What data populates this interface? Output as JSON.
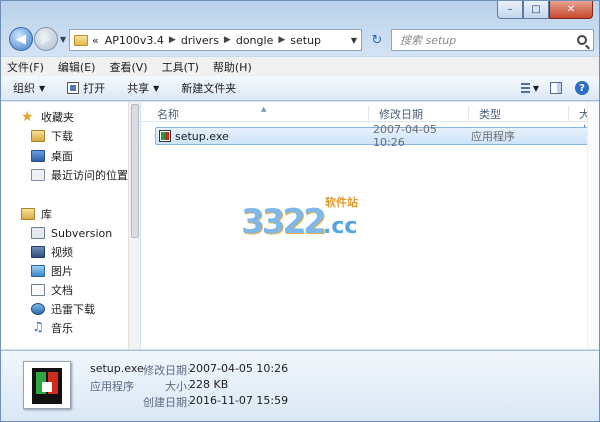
{
  "window": {
    "caption_min": "–",
    "caption_max": "□",
    "caption_close": "✕"
  },
  "address": {
    "prefix": "«",
    "crumbs": [
      "AP100v3.4",
      "drivers",
      "dongle",
      "setup"
    ],
    "separator": "▶",
    "search_placeholder": "搜索 setup"
  },
  "menubar": {
    "items": [
      "文件(F)",
      "编辑(E)",
      "查看(V)",
      "工具(T)",
      "帮助(H)"
    ]
  },
  "toolbar": {
    "organize": "组织",
    "open": "打开",
    "share": "共享",
    "new_folder": "新建文件夹",
    "help": "?"
  },
  "navpane": {
    "favorites": "收藏夹",
    "fav_items": [
      "下载",
      "桌面",
      "最近访问的位置"
    ],
    "libraries": "库",
    "lib_items": [
      "Subversion",
      "视频",
      "图片",
      "文档",
      "迅雷下载",
      "音乐"
    ]
  },
  "filelist": {
    "columns": [
      "名称",
      "修改日期",
      "类型",
      "大小"
    ],
    "rows": [
      {
        "name": "setup.exe",
        "modified": "2007-04-05 10:26",
        "type": "应用程序"
      }
    ]
  },
  "watermark": {
    "number": "3322",
    "domain": ".cc",
    "tag": "软件站"
  },
  "details": {
    "filename": "setup.exe",
    "filetype": "应用程序",
    "modified_label": "修改日期:",
    "modified_value": "2007-04-05 10:26",
    "size_label": "大小:",
    "size_value": "228 KB",
    "created_label": "创建日期:",
    "created_value": "2016-11-07 15:59"
  }
}
